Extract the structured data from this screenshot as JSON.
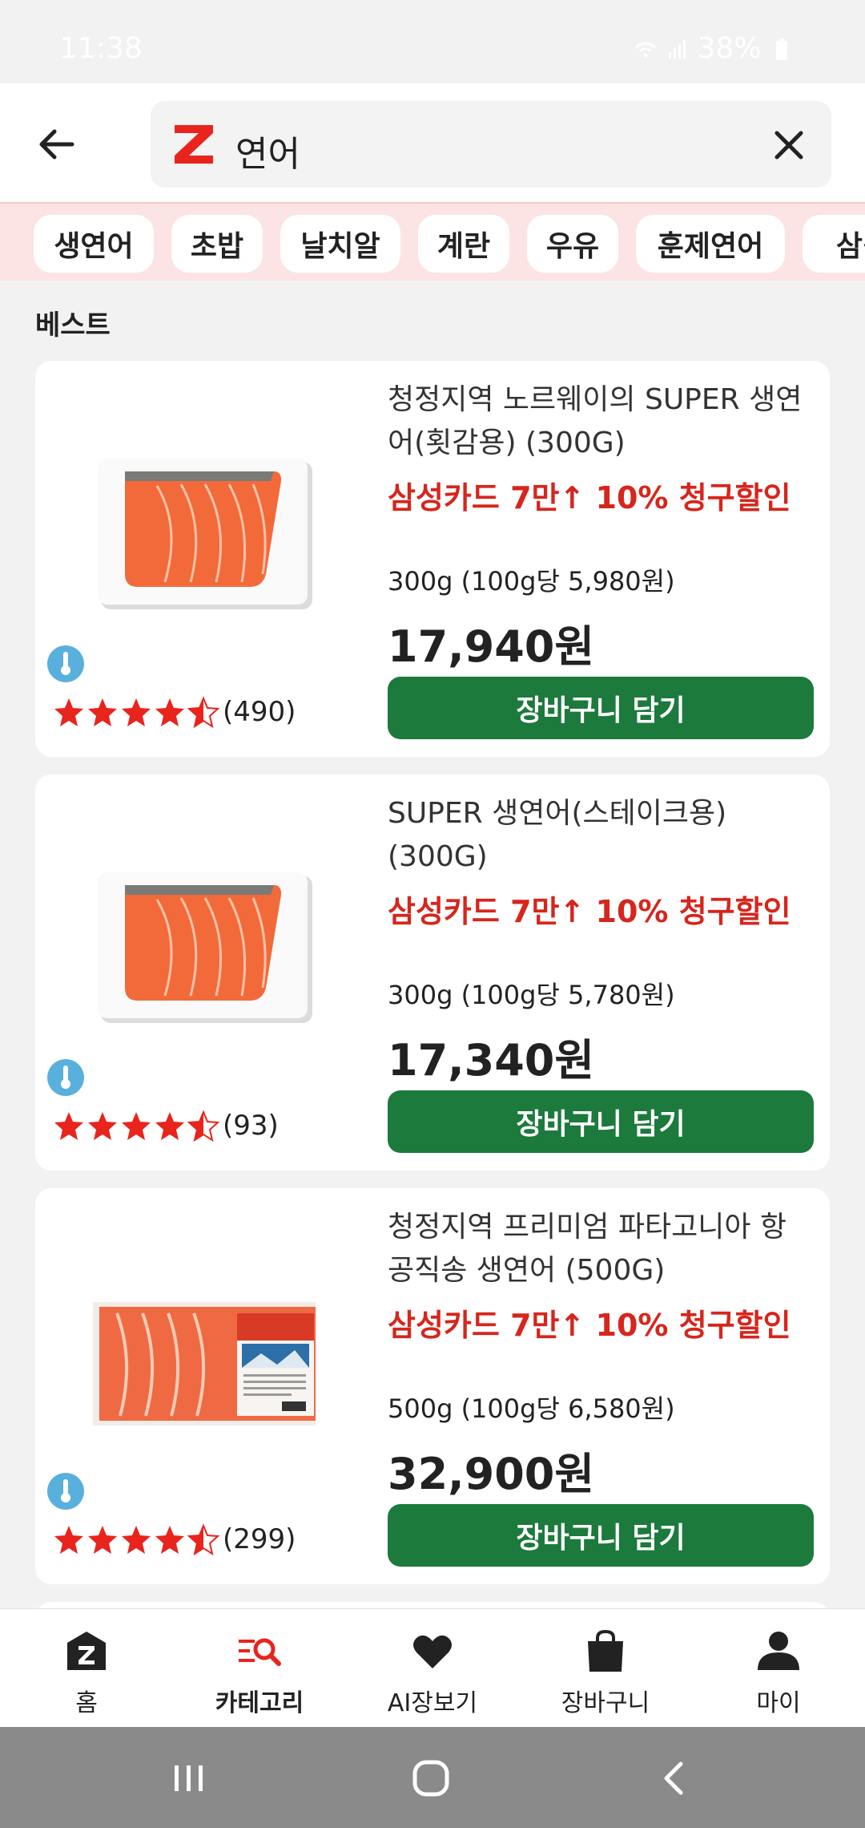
{
  "status_bar": {
    "time": "11:38",
    "battery": "38%"
  },
  "header": {
    "search_query": "연어"
  },
  "chips": [
    "생연어",
    "초밥",
    "날치알",
    "계란",
    "우유",
    "훈제연어",
    "삼겹"
  ],
  "section": {
    "title": "베스트"
  },
  "products": [
    {
      "name": "청정지역 노르웨이의 SUPER 생연어(횟감용) (300G)",
      "promo": "삼성카드 7만↑ 10% 청구할인",
      "unit_price": "300g (100g당 5,980원)",
      "price": "17,940원",
      "rating": 4.5,
      "review_count": "(490)",
      "cart_label": "장바구니 담기"
    },
    {
      "name": " SUPER 생연어(스테이크용) (300G)",
      "promo": "삼성카드 7만↑ 10% 청구할인",
      "unit_price": "300g (100g당 5,780원)",
      "price": "17,340원",
      "rating": 4.5,
      "review_count": "(93)",
      "cart_label": "장바구니 담기"
    },
    {
      "name": "청정지역 프리미엄 파타고니아 항공직송 생연어 (500G)",
      "promo": "삼성카드 7만↑ 10% 청구할인",
      "unit_price": "500g (100g당 6,580원)",
      "price": "32,900원",
      "rating": 4.5,
      "review_count": "(299)",
      "cart_label": "장바구니 담기"
    }
  ],
  "bottom_nav": [
    {
      "label": "홈",
      "icon": "home-icon",
      "active": false
    },
    {
      "label": "카테고리",
      "icon": "category-icon",
      "active": true
    },
    {
      "label": "AI장보기",
      "icon": "heart-icon",
      "active": false
    },
    {
      "label": "장바구니",
      "icon": "shopping-bag-icon",
      "active": false
    },
    {
      "label": "마이",
      "icon": "person-icon",
      "active": false
    }
  ],
  "colors": {
    "brand_red": "#e8241c",
    "promo_red": "#d6261d",
    "cart_green": "#1c7a3c",
    "chip_bar_bg": "#fbe4e3"
  }
}
